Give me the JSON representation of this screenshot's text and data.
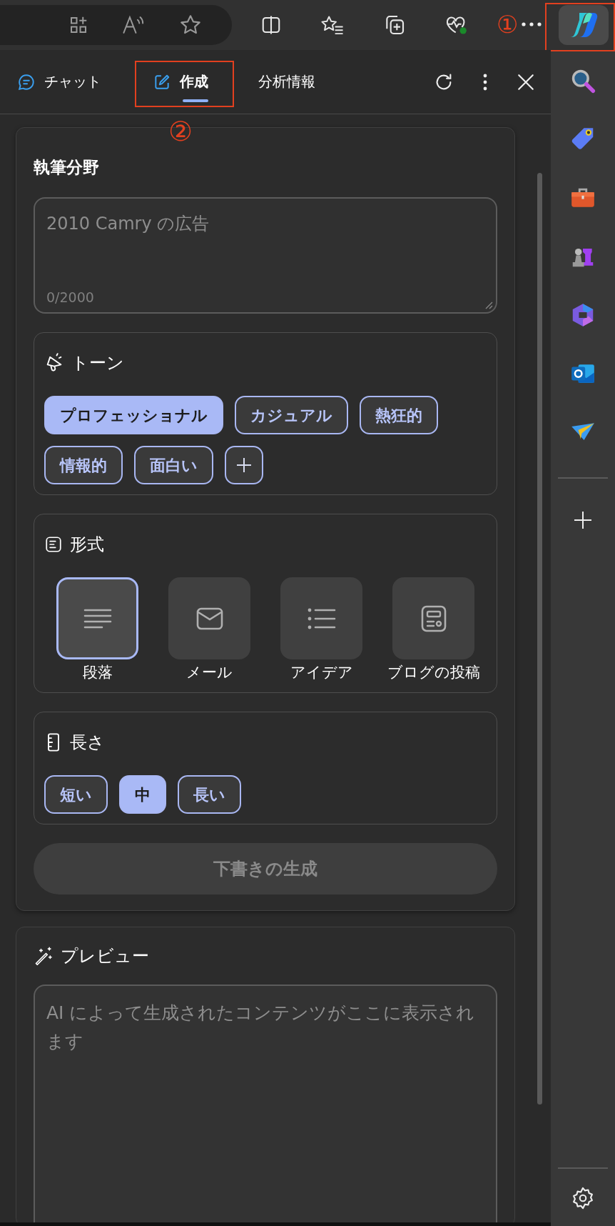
{
  "toolbar": {
    "annotation": "①"
  },
  "tabs": [
    {
      "label": "チャット",
      "kind": "chat",
      "selected": false
    },
    {
      "label": "作成",
      "kind": "compose",
      "selected": true
    },
    {
      "label": "分析情報",
      "kind": "insights",
      "selected": false
    }
  ],
  "tab_annotation": "②",
  "compose": {
    "title": "執筆分野",
    "topic": {
      "placeholder": "2010 Camry の広告",
      "counter": "0/2000"
    },
    "tone": {
      "title": "トーン",
      "options": [
        {
          "label": "プロフェッショナル",
          "selected": true
        },
        {
          "label": "カジュアル",
          "selected": false
        },
        {
          "label": "熱狂的",
          "selected": false
        },
        {
          "label": "情報的",
          "selected": false
        },
        {
          "label": "面白い",
          "selected": false
        }
      ]
    },
    "format": {
      "title": "形式",
      "options": [
        {
          "label": "段落",
          "kind": "paragraph",
          "selected": true
        },
        {
          "label": "メール",
          "kind": "email",
          "selected": false
        },
        {
          "label": "アイデア",
          "kind": "ideas",
          "selected": false
        },
        {
          "label": "ブログの投稿",
          "kind": "blog",
          "selected": false
        }
      ]
    },
    "length": {
      "title": "長さ",
      "options": [
        {
          "label": "短い",
          "selected": false
        },
        {
          "label": "中",
          "selected": true
        },
        {
          "label": "長い",
          "selected": false
        }
      ]
    },
    "generate_button": {
      "label": "下書きの生成",
      "disabled": true
    }
  },
  "preview": {
    "title": "プレビュー",
    "placeholder": "AI によって生成されたコンテンツがここに表示されます"
  }
}
